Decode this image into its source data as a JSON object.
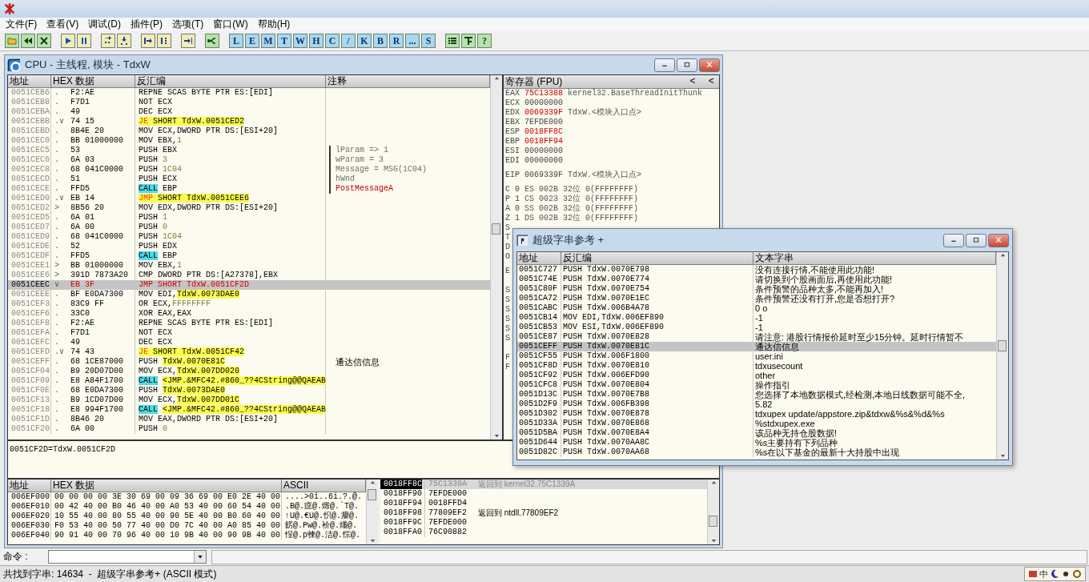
{
  "menu": [
    "文件(F)",
    "查看(V)",
    "调试(D)",
    "插件(P)",
    "选项(T)",
    "窗口(W)",
    "帮助(H)"
  ],
  "toolbar": {
    "letter_buttons": [
      "L",
      "E",
      "M",
      "T",
      "W",
      "H",
      "C",
      "/",
      "K",
      "B",
      "R",
      "...",
      "S"
    ],
    "help_button": "?"
  },
  "cpu_window": {
    "title": "CPU - 主线程, 模块 - TdxW"
  },
  "disasm": {
    "columns": [
      "地址",
      "HEX 数据",
      "反汇编",
      "注释"
    ],
    "rows": [
      {
        "address": "0051CEB6",
        "marker": ".",
        "hex": "F2:AE",
        "op": "REPNE",
        "arg": "SCAS BYTE PTR ES:[EDI]",
        "kind": "plain",
        "selected": false
      },
      {
        "address": "0051CEB8",
        "marker": ".",
        "hex": "F7D1",
        "op": "NOT",
        "arg": "ECX",
        "kind": "plain",
        "selected": false
      },
      {
        "address": "0051CEBA",
        "marker": ".",
        "hex": "49",
        "op": "DEC",
        "arg": "ECX",
        "kind": "plain",
        "selected": false
      },
      {
        "address": "0051CEBB",
        "marker": ".∨",
        "hex": "74 15",
        "op": "JE",
        "operand": {
          "text": "SHORT TdxW.0051CED2",
          "kind": "ref"
        },
        "kind": "jump",
        "selected": false
      },
      {
        "address": "0051CEBD",
        "marker": ".",
        "hex": "8B4E 20",
        "op": "MOV",
        "arg": "ECX,DWORD PTR DS:[ESI+20]",
        "kind": "plain",
        "selected": false
      },
      {
        "address": "0051CEC0",
        "marker": ".",
        "hex": "BB 01000000",
        "op": "MOV",
        "arg": "EBX,",
        "operand": {
          "text": "1",
          "kind": "const"
        },
        "kind": "plain",
        "selected": false
      },
      {
        "address": "0051CEC5",
        "marker": ".",
        "hex": "53",
        "op": "PUSH",
        "arg": "EBX",
        "kind": "plain",
        "selected": false,
        "comment": {
          "text": "lParam => 1",
          "kind": "arg"
        }
      },
      {
        "address": "0051CEC6",
        "marker": ".",
        "hex": "6A 03",
        "op": "PUSH",
        "operand": {
          "text": "3",
          "kind": "const"
        },
        "kind": "plain",
        "selected": false,
        "comment": {
          "text": "wParam = 3",
          "kind": "arg"
        }
      },
      {
        "address": "0051CEC8",
        "marker": ".",
        "hex": "68 041C0000",
        "op": "PUSH",
        "operand": {
          "text": "1C04",
          "kind": "const"
        },
        "kind": "plain",
        "selected": false,
        "comment": {
          "text": "Message = MSG(1C04)",
          "kind": "arg"
        }
      },
      {
        "address": "0051CECD",
        "marker": ".",
        "hex": "51",
        "op": "PUSH",
        "arg": "ECX",
        "kind": "plain",
        "selected": false,
        "comment": {
          "text": "hWnd",
          "kind": "arg"
        }
      },
      {
        "address": "0051CECE",
        "marker": ".",
        "hex": "FFD5",
        "op": "CALL",
        "arg": "EBP",
        "kind": "call",
        "selected": false,
        "comment": {
          "text": "PostMessageA",
          "kind": "call"
        }
      },
      {
        "address": "0051CED0",
        "marker": ".∨",
        "hex": "EB 14",
        "op": "JMP",
        "operand": {
          "text": "SHORT TdxW.0051CEE6",
          "kind": "ref"
        },
        "kind": "jump",
        "selected": false
      },
      {
        "address": "0051CED2",
        "marker": ">",
        "hex": "8B56 20",
        "op": "MOV",
        "arg": "EDX,DWORD PTR DS:[ESI+20]",
        "kind": "plain",
        "selected": false
      },
      {
        "address": "0051CED5",
        "marker": ".",
        "hex": "6A 01",
        "op": "PUSH",
        "operand": {
          "text": "1",
          "kind": "const"
        },
        "kind": "plain",
        "selected": false
      },
      {
        "address": "0051CED7",
        "marker": ".",
        "hex": "6A 00",
        "op": "PUSH",
        "operand": {
          "text": "0",
          "kind": "const"
        },
        "kind": "plain",
        "selected": false
      },
      {
        "address": "0051CED9",
        "marker": ".",
        "hex": "68 041C0000",
        "op": "PUSH",
        "operand": {
          "text": "1C04",
          "kind": "const"
        },
        "kind": "plain",
        "selected": false
      },
      {
        "address": "0051CEDE",
        "marker": ".",
        "hex": "52",
        "op": "PUSH",
        "arg": "EDX",
        "kind": "plain",
        "selected": false
      },
      {
        "address": "0051CEDF",
        "marker": ".",
        "hex": "FFD5",
        "op": "CALL",
        "arg": "EBP",
        "kind": "call",
        "selected": false
      },
      {
        "address": "0051CEE1",
        "marker": ">",
        "hex": "BB 01000000",
        "op": "MOV",
        "arg": "EBX,",
        "operand": {
          "text": "1",
          "kind": "const"
        },
        "kind": "plain",
        "selected": false
      },
      {
        "address": "0051CEE6",
        "marker": ">",
        "hex": "391D 7873A20",
        "op": "CMP",
        "arg": "DWORD PTR DS:[A27378],EBX",
        "kind": "plain",
        "selected": false
      },
      {
        "address": "0051CEEC",
        "marker": "∨",
        "hex": "EB 3F",
        "op": "JMP",
        "operand": {
          "text": "SHORT TdxW.0051CF2D",
          "kind": "ref"
        },
        "kind": "jump",
        "selected": true
      },
      {
        "address": "0051CEEE",
        "marker": ".",
        "hex": "BF E0DA7300",
        "op": "MOV",
        "arg": "EDI,",
        "operand": {
          "text": "TdxW.0073DAE0",
          "kind": "ref"
        },
        "kind": "plain",
        "selected": false
      },
      {
        "address": "0051CEF3",
        "marker": ".",
        "hex": "83C9 FF",
        "op": "OR",
        "arg": "ECX,",
        "operand": {
          "text": "FFFFFFFF",
          "kind": "const"
        },
        "kind": "plain",
        "selected": false
      },
      {
        "address": "0051CEF6",
        "marker": ".",
        "hex": "33C0",
        "op": "XOR",
        "arg": "EAX,EAX",
        "kind": "plain",
        "selected": false
      },
      {
        "address": "0051CEF8",
        "marker": ".",
        "hex": "F2:AE",
        "op": "REPNE",
        "arg": "SCAS BYTE PTR ES:[EDI]",
        "kind": "plain",
        "selected": false
      },
      {
        "address": "0051CEFA",
        "marker": ".",
        "hex": "F7D1",
        "op": "NOT",
        "arg": "ECX",
        "kind": "plain",
        "selected": false
      },
      {
        "address": "0051CEFC",
        "marker": ".",
        "hex": "49",
        "op": "DEC",
        "arg": "ECX",
        "kind": "plain",
        "selected": false
      },
      {
        "address": "0051CEFD",
        "marker": ".∨",
        "hex": "74 43",
        "op": "JE",
        "operand": {
          "text": "SHORT TdxW.0051CF42",
          "kind": "ref"
        },
        "kind": "jump",
        "selected": false
      },
      {
        "address": "0051CEFF",
        "marker": ".",
        "hex": "68 1CE87000",
        "op": "PUSH",
        "operand": {
          "text": "TdxW.0070E81C",
          "kind": "ref"
        },
        "kind": "plain",
        "selected": false,
        "comment": {
          "text": "通达信信息",
          "kind": "note"
        }
      },
      {
        "address": "0051CF04",
        "marker": ".",
        "hex": "B9 20D07D00",
        "op": "MOV",
        "arg": "ECX,",
        "operand": {
          "text": "TdxW.007DD020",
          "kind": "ref"
        },
        "kind": "plain",
        "selected": false
      },
      {
        "address": "0051CF09",
        "marker": ".",
        "hex": "E8 A84F1700",
        "op": "CALL",
        "operand": {
          "text": "<JMP.&MFC42.#860_??4CString@@QAEAB",
          "kind": "ref"
        },
        "kind": "call",
        "selected": false
      },
      {
        "address": "0051CF0E",
        "marker": ".",
        "hex": "68 E0DA7300",
        "op": "PUSH",
        "operand": {
          "text": "TdxW.0073DAE0",
          "kind": "ref"
        },
        "kind": "plain",
        "selected": false
      },
      {
        "address": "0051CF13",
        "marker": ".",
        "hex": "B9 1CD07D00",
        "op": "MOV",
        "arg": "ECX,",
        "operand": {
          "text": "TdxW.007DD01C",
          "kind": "ref"
        },
        "kind": "plain",
        "selected": false
      },
      {
        "address": "0051CF18",
        "marker": ".",
        "hex": "E8 994F1700",
        "op": "CALL",
        "operand": {
          "text": "<JMP.&MFC42.#860_??4CString@@QAEAB",
          "kind": "ref"
        },
        "kind": "call",
        "selected": false
      },
      {
        "address": "0051CF1D",
        "marker": ".",
        "hex": "8B46 20",
        "op": "MOV",
        "arg": "EAX,DWORD PTR DS:[ESI+20]",
        "kind": "plain",
        "selected": false
      },
      {
        "address": "0051CF20",
        "marker": ".",
        "hex": "6A 00",
        "op": "PUSH",
        "operand": {
          "text": "0",
          "kind": "const"
        },
        "kind": "plain",
        "selected": false
      }
    ]
  },
  "registers": {
    "title": "寄存器 (FPU)",
    "nav_buttons": [
      "<",
      "<"
    ],
    "rows": [
      {
        "kind": "reg",
        "name": "EAX",
        "value": "75C13388",
        "changed": true,
        "info": "kernel32.BaseThreadInitThunk"
      },
      {
        "kind": "reg",
        "name": "ECX",
        "value": "00000000",
        "changed": false
      },
      {
        "kind": "reg",
        "name": "EDX",
        "value": "0069339F",
        "changed": true,
        "info": "TdxW.<模块入口点>"
      },
      {
        "kind": "reg",
        "name": "EBX",
        "value": "7EFDE000",
        "changed": false
      },
      {
        "kind": "reg",
        "name": "ESP",
        "value": "0018FF8C",
        "changed": true
      },
      {
        "kind": "reg",
        "name": "EBP",
        "value": "0018FF94",
        "changed": true
      },
      {
        "kind": "reg",
        "name": "ESI",
        "value": "00000000",
        "changed": false
      },
      {
        "kind": "reg",
        "name": "EDI",
        "value": "00000000",
        "changed": false
      },
      {
        "kind": "gap"
      },
      {
        "kind": "reg",
        "name": "EIP",
        "value": "0069339F",
        "changed": false,
        "info": "TdxW.<模块入口点>"
      },
      {
        "kind": "gap"
      },
      {
        "kind": "reg",
        "name": "C",
        "value": "0",
        "changed": false,
        "info": "ES 002B 32位 0(FFFFFFFF)"
      },
      {
        "kind": "reg",
        "name": "P",
        "value": "1",
        "changed": false,
        "info": "CS 0023 32位 0(FFFFFFFF)"
      },
      {
        "kind": "reg",
        "name": "A",
        "value": "0",
        "changed": false,
        "info": "SS 002B 32位 0(FFFFFFFF)"
      },
      {
        "kind": "reg",
        "name": "Z",
        "value": "1",
        "changed": false,
        "info": "DS 002B 32位 0(FFFFFFFF)"
      },
      {
        "kind": "reg",
        "name": "S"
      },
      {
        "kind": "reg",
        "name": "T"
      },
      {
        "kind": "reg",
        "name": "D"
      },
      {
        "kind": "reg",
        "name": "O"
      },
      {
        "kind": "gap"
      },
      {
        "kind": "reg",
        "name": "E"
      },
      {
        "kind": "gap"
      },
      {
        "kind": "gap"
      },
      {
        "kind": "reg",
        "name": "S"
      },
      {
        "kind": "reg",
        "name": "S"
      },
      {
        "kind": "reg",
        "name": "S"
      },
      {
        "kind": "reg",
        "name": "S"
      },
      {
        "kind": "reg",
        "name": "S"
      },
      {
        "kind": "reg",
        "name": "S"
      },
      {
        "kind": "gap"
      },
      {
        "kind": "gap"
      },
      {
        "kind": "reg",
        "name": "F"
      },
      {
        "kind": "reg",
        "name": "F"
      }
    ]
  },
  "info_line": "0051CF2D=TdxW.0051CF2D",
  "dump": {
    "columns": [
      "地址",
      "HEX 数据",
      "ASCII"
    ],
    "rows": [
      {
        "address": "006EF000",
        "hex": "00 00 00 00 3E 30 69 00 09 36 69 00 E0 2E 40 00",
        "ascii": "....>0i..6i.?.@."
      },
      {
        "address": "006EF010",
        "hex": "00 42 40 00 B0 46 40 00 A0 53 40 00 60 54 40 00",
        "ascii": ".B@.癋@.燬@.`T@."
      },
      {
        "address": "006EF020",
        "hex": "10 55 40 00 80 55 40 00 90 5E 40 00 B0 60 40 00",
        "ascii": "↑U@.€U@.怾@.癭@."
      },
      {
        "address": "006EF030",
        "hex": "F0 53 40 00 50 77 40 00 D0 7C 40 00 A0 85 40 00",
        "ascii": "餝@.Pw@.衸@.爡@."
      },
      {
        "address": "006EF040",
        "hex": "90 91 40 00 70 96 40 00 10 9B 40 00 90 9B 40 00",
        "ascii": "悜@.p朄@.洁@.悰@."
      }
    ]
  },
  "stack": {
    "rows": [
      {
        "address": "0018FF8C",
        "value": "75C1339A",
        "comment": "返回到 kernel32.75C1339A",
        "selected": true
      },
      {
        "address": "0018FF90",
        "value": "7EFDE000",
        "selected": false
      },
      {
        "address": "0018FF94",
        "value": "0018FFD4",
        "selected": false
      },
      {
        "address": "0018FF98",
        "value": "77809EF2",
        "comment": "返回到 ntdll.77809EF2",
        "selected": false
      },
      {
        "address": "0018FF9C",
        "value": "7EFDE000",
        "selected": false
      },
      {
        "address": "0018FFA0",
        "value": "76C90882",
        "selected": false
      }
    ]
  },
  "command_bar": {
    "label": "命令 :"
  },
  "status_bar": {
    "text": "共找到字串: 14634  -  超级字串参考+ (ASCII 模式)",
    "ime_label": "中"
  },
  "string_window": {
    "title": "超级字串参考 +",
    "columns": [
      "地址",
      "反汇编",
      "文本字串"
    ],
    "rows": [
      {
        "address": "0051C727",
        "asm": "PUSH TdxW.0070E798",
        "text": "没有连接行情,不能使用此功能!",
        "selected": false
      },
      {
        "address": "0051C74E",
        "asm": "PUSH TdxW.0070E774",
        "text": "请切换到个股画面后,再使用此功能!",
        "selected": false
      },
      {
        "address": "0051C80F",
        "asm": "PUSH TdxW.0070E754",
        "text": "条件预警的品种太多,不能再加入!",
        "selected": false
      },
      {
        "address": "0051CA72",
        "asm": "PUSH TdxW.0070E1EC",
        "text": "条件预警还没有打开,您是否想打开?",
        "selected": false
      },
      {
        "address": "0051CABC",
        "asm": "PUSH TdxW.006B4A78",
        "text": "0 o",
        "selected": false
      },
      {
        "address": "0051CB14",
        "asm": "MOV EDI,TdxW.006EF890",
        "text": "-1",
        "selected": false
      },
      {
        "address": "0051CB53",
        "asm": "MOV ESI,TdxW.006EF890",
        "text": "-1",
        "selected": false
      },
      {
        "address": "0051CE87",
        "asm": "PUSH TdxW.0070E828",
        "text": "请注意: 港股行情报价延时至少15分钟。延时行情暂不",
        "selected": false
      },
      {
        "address": "0051CEFF",
        "asm": "PUSH TdxW.0070E81C",
        "text": "通达信信息",
        "selected": true
      },
      {
        "address": "0051CF55",
        "asm": "PUSH TdxW.006F1800",
        "text": "user.ini",
        "selected": false
      },
      {
        "address": "0051CF8D",
        "asm": "PUSH TdxW.0070E810",
        "text": "tdxusecount",
        "selected": false
      },
      {
        "address": "0051CF92",
        "asm": "PUSH TdxW.006EFD90",
        "text": "other",
        "selected": false
      },
      {
        "address": "0051CFC8",
        "asm": "PUSH TdxW.0070E804",
        "text": "操作指引",
        "selected": false
      },
      {
        "address": "0051D13C",
        "asm": "PUSH TdxW.0070E7B8",
        "text": "您选择了本地数据模式,经检测,本地日线数据可能不全,",
        "selected": false
      },
      {
        "address": "0051D2F9",
        "asm": "PUSH TdxW.006FB398",
        "text": "5.82",
        "selected": false
      },
      {
        "address": "0051D302",
        "asm": "PUSH TdxW.0070E878",
        "text": "tdxupex update/appstore.zip&tdxw&%s&%d&%s",
        "selected": false
      },
      {
        "address": "0051D33A",
        "asm": "PUSH TdxW.0070E868",
        "text": "%stdxupex.exe",
        "selected": false
      },
      {
        "address": "0051D5BA",
        "asm": "PUSH TdxW.0070E8A4",
        "text": "该品种无持仓股数据!",
        "selected": false
      },
      {
        "address": "0051D644",
        "asm": "PUSH TdxW.0070AA8C",
        "text": "%s主要持有下列品种",
        "selected": false
      },
      {
        "address": "0051D82C",
        "asm": "PUSH TdxW.0070AA68",
        "text": "%s在以下基金的最新十大持股中出现",
        "selected": false
      }
    ]
  }
}
